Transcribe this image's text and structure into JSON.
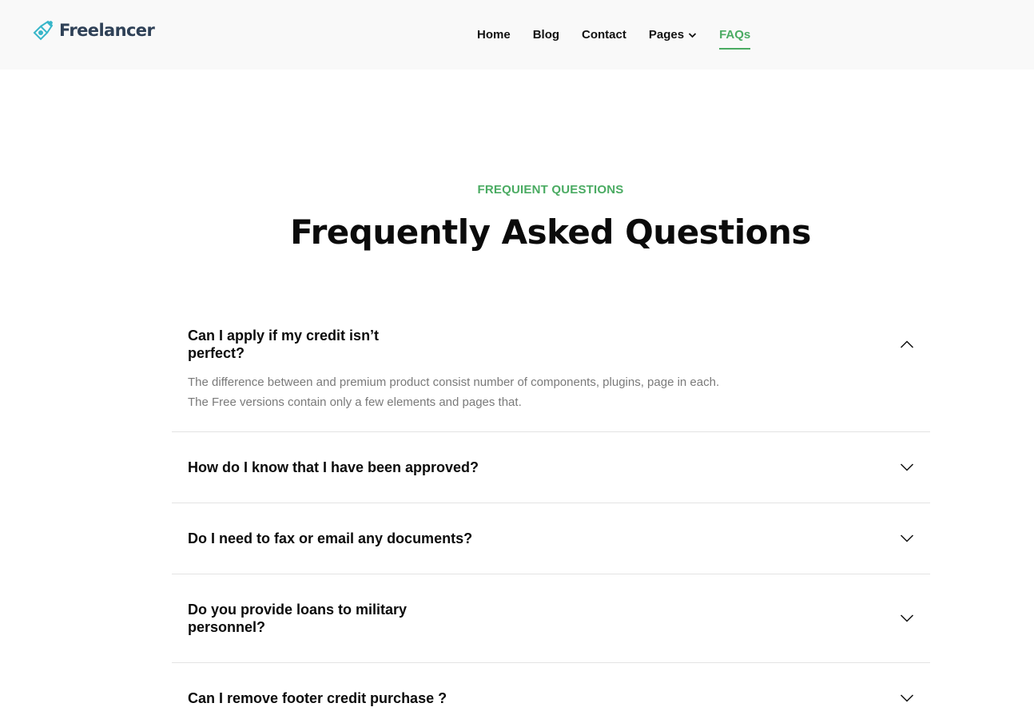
{
  "brand": {
    "name": "Freelancer",
    "accent": "#4aab62",
    "logo_color": "#2f4157",
    "icon_color": "#37b6c9"
  },
  "nav": {
    "items": [
      {
        "label": "Home"
      },
      {
        "label": "Blog"
      },
      {
        "label": "Contact"
      },
      {
        "label": "Pages",
        "dropdown": true
      },
      {
        "label": "FAQs",
        "active": true
      }
    ]
  },
  "hero": {
    "eyebrow": "FREQUIENT QUESTIONS",
    "title": "Frequently Asked Questions"
  },
  "faq": {
    "items": [
      {
        "question": "Can I apply if my credit isn’t perfect?",
        "answer": "The difference between and premium product consist number of components, plugins, page in each. The Free versions contain only a few elements and pages that.",
        "expanded": true,
        "icon": "chevron-up-icon"
      },
      {
        "question": "How do I know that I have been approved?",
        "expanded": false,
        "icon": "chevron-down-icon"
      },
      {
        "question": "Do I need to fax or email any documents?",
        "expanded": false,
        "icon": "chevron-down-icon"
      },
      {
        "question": "Do you provide loans to military personnel?",
        "expanded": false,
        "icon": "chevron-down-icon"
      },
      {
        "question": "Can I remove footer credit purchase ?",
        "expanded": false,
        "icon": "chevron-down-icon"
      }
    ]
  }
}
